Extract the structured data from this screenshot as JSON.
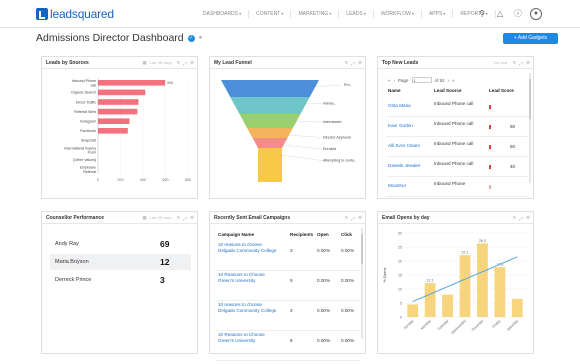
{
  "brand": {
    "logo_text": "leadsquared"
  },
  "nav": {
    "items": [
      "DASHBOARDS",
      "CONTENT",
      "MARKETING",
      "LEADS",
      "WORKFLOW",
      "APPS",
      "REPORTS"
    ],
    "icons": [
      "search-icon",
      "bell-icon",
      "help-icon",
      "user-icon"
    ]
  },
  "page": {
    "title": "Admissions Director Dashboard",
    "add_button": "+ Add Gadgets"
  },
  "panels": {
    "leads": {
      "title": "Leads by Sources",
      "range": "Last 180 days"
    },
    "funnel": {
      "title": "My Lead Funnel"
    },
    "new_leads": {
      "title": "Top New Leads",
      "range": "This Year"
    },
    "counsellor": {
      "title": "Counsellor Performance",
      "range": "Last 180 days"
    },
    "campaigns": {
      "title": "Recently Sent Email Campaigns"
    },
    "opens": {
      "title": "Email Opens by day"
    }
  },
  "leads_chart": {
    "type": "bar",
    "orientation": "horizontal",
    "categories": [
      "Inbound Phone call",
      "Organic Search",
      "Direct Traffic",
      "Referral Sites",
      "Instagram",
      "Facebook",
      "Snapchat",
      "International Inquiry Form",
      "[Other Values]",
      "Employee Referral"
    ],
    "values": [
      596,
      420,
      360,
      350,
      280,
      265,
      0,
      0,
      0,
      0
    ],
    "value_label": "596",
    "xlim": [
      0,
      800
    ],
    "xticks": [
      "0",
      "200",
      "400",
      "600",
      "800"
    ],
    "color": "#f2717e"
  },
  "funnel": {
    "stages": [
      {
        "label": "Pro..",
        "color": "#4a8fd8"
      },
      {
        "label": "Interes..",
        "color": "#6ec6c8"
      },
      {
        "label": "Interviewed",
        "color": "#9ad069"
      },
      {
        "label": "Director Approval",
        "color": "#f4b45b"
      },
      {
        "label": "Enrolled",
        "color": "#f48c8c"
      },
      {
        "label": "Attempting to conta..",
        "color": "#f5c945"
      }
    ]
  },
  "new_leads": {
    "pager": {
      "page_label": "Page",
      "page_value": "1",
      "of_label": "of 92"
    },
    "columns": [
      "Name",
      "Lead Source",
      "Lead Score"
    ],
    "rows": [
      {
        "name": "Orita Maria",
        "source": "Inbound Phone call",
        "score": "",
        "strong": true
      },
      {
        "name": "Kaur Gurbin",
        "source": "Inbound Phone call",
        "score": "60",
        "strong": true
      },
      {
        "name": "Alli Svcs Cleam",
        "source": "Inbound Phone call",
        "score": "50",
        "strong": true
      },
      {
        "name": "Daniels Jewaler",
        "source": "Inbound Phone call",
        "score": "40",
        "strong": true
      },
      {
        "name": "Mcarthur",
        "source": "Inbound Phone",
        "score": "",
        "strong": false
      }
    ]
  },
  "counsellor": {
    "rows": [
      {
        "name": "Andy Ray",
        "value": "69"
      },
      {
        "name": "Maria Boyson",
        "value": "12"
      },
      {
        "name": "Derreck Prince",
        "value": "3"
      }
    ]
  },
  "campaigns": {
    "columns": [
      "Campaign Name",
      "Recipients",
      "Open",
      "Click"
    ],
    "rows": [
      {
        "name": "10 reasons to choose Delgado Community College",
        "recipients": "3",
        "open": "0.00%",
        "click": "0.00%"
      },
      {
        "name": "10 Reasons to Choose Green's University",
        "recipients": "9",
        "open": "0.00%",
        "click": "0.00%"
      },
      {
        "name": "10 reasons to choose Delgado Community College",
        "recipients": "3",
        "open": "0.00%",
        "click": "0.00%"
      },
      {
        "name": "10 Reasons to Choose Green's University",
        "recipients": "9",
        "open": "0.00%",
        "click": "0.00%"
      }
    ]
  },
  "chart_data": {
    "type": "bar",
    "title": "Email Opens by day",
    "categories": [
      "Sunday",
      "Monday",
      "Tuesday",
      "Wednesday",
      "Thursday",
      "Friday",
      "Saturday"
    ],
    "values": [
      4.5,
      12.1,
      8.0,
      22.1,
      26.3,
      17.8,
      6.5
    ],
    "data_labels": [
      "",
      "12.1",
      "",
      "22.1",
      "26.3",
      "17.8",
      ""
    ],
    "trend": [
      5.5,
      21.5
    ],
    "ylabel": "% Opens",
    "ylim": [
      0,
      30
    ],
    "yticks": [
      "0",
      "5",
      "10",
      "15",
      "20",
      "25",
      "30"
    ],
    "colors": {
      "bar": "#f7d57e",
      "trend": "#4aa3df"
    }
  }
}
